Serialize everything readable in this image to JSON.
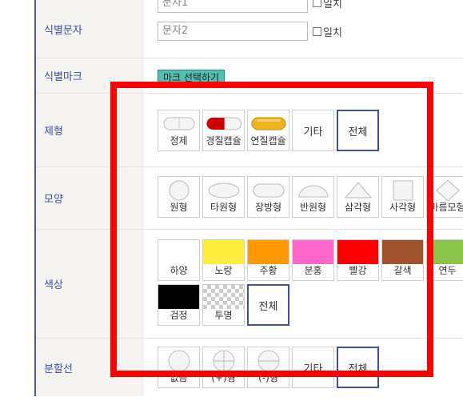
{
  "identifier": {
    "label": "식별문자",
    "field1_value": "문자1",
    "field2_value": "문자2",
    "match_label": "일치"
  },
  "mark": {
    "label": "식별마크",
    "button": "마크 선택하기"
  },
  "dosage_form": {
    "label": "제형",
    "options": [
      {
        "name": "정제",
        "icon": "tablet-icon"
      },
      {
        "name": "경질캡슐",
        "icon": "hard-capsule-icon"
      },
      {
        "name": "연질캡슐",
        "icon": "soft-capsule-icon"
      }
    ],
    "etc": "기타",
    "all": "전체"
  },
  "shape": {
    "label": "모양",
    "options": [
      {
        "name": "원형",
        "icon": "circle-icon"
      },
      {
        "name": "타원형",
        "icon": "oval-icon"
      },
      {
        "name": "장방형",
        "icon": "oblong-icon"
      },
      {
        "name": "반원형",
        "icon": "semicircle-icon"
      },
      {
        "name": "삼각형",
        "icon": "triangle-icon"
      },
      {
        "name": "사각형",
        "icon": "square-icon"
      },
      {
        "name": "마름모형",
        "icon": "diamond-icon"
      }
    ]
  },
  "color": {
    "label": "색상",
    "options": [
      {
        "name": "하양",
        "hex": "#ffffff"
      },
      {
        "name": "노랑",
        "hex": "#ffeb3b"
      },
      {
        "name": "주황",
        "hex": "#ff9800"
      },
      {
        "name": "분홍",
        "hex": "#ff66cc"
      },
      {
        "name": "빨강",
        "hex": "#ff0000"
      },
      {
        "name": "갈색",
        "hex": "#a0522d"
      },
      {
        "name": "연두",
        "hex": "#8bc34a"
      },
      {
        "name": "검정",
        "hex": "#000000"
      },
      {
        "name": "투명",
        "hex": "transparent"
      }
    ],
    "all": "전체"
  },
  "score_line": {
    "label": "분할선",
    "options": [
      {
        "name": "없음",
        "icon": "no-line-icon"
      },
      {
        "name": "(+)형",
        "icon": "plus-line-icon"
      },
      {
        "name": "(-)형",
        "icon": "minus-line-icon"
      }
    ],
    "etc": "기타",
    "all": "전체"
  },
  "colors": {
    "accent": "#3a4fb0",
    "highlight": "#ff0000",
    "label_bg": "#f5f3ef"
  }
}
